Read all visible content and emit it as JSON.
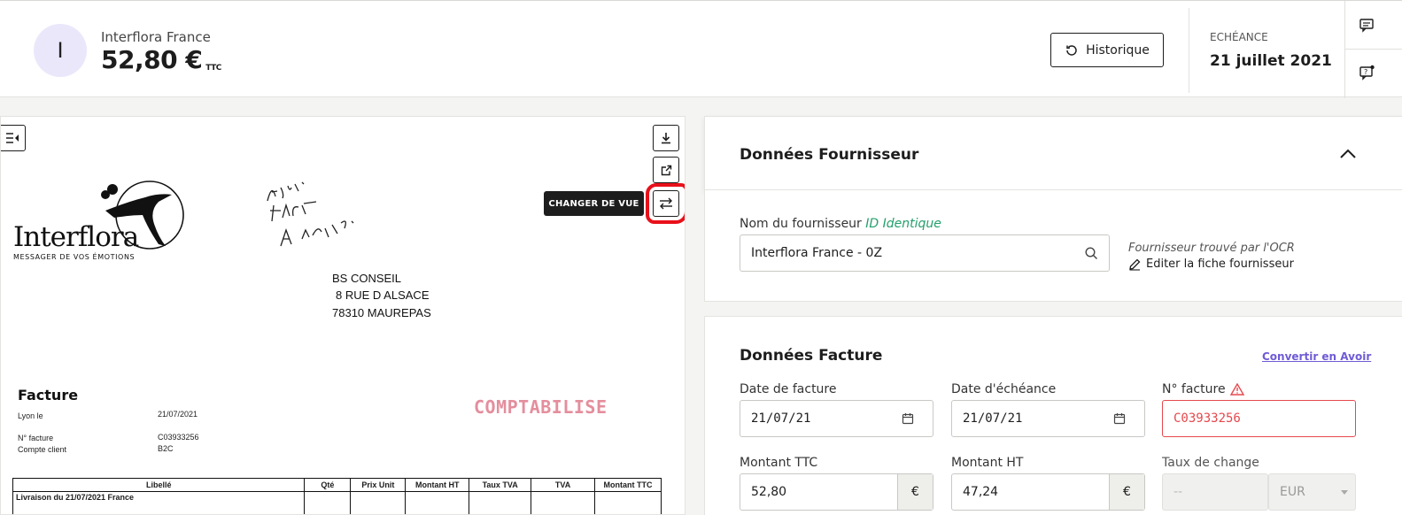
{
  "header": {
    "avatar_letter": "I",
    "supplier_name": "Interflora France",
    "amount": "52,80 €",
    "amount_suffix": "TTC",
    "history_button": "Historique",
    "due_label": "ECHÉANCE",
    "due_date": "21 juillet 2021"
  },
  "viewer": {
    "tooltip": "CHANGER DE VUE",
    "document": {
      "logo_word": "Interflora",
      "logo_tagline": "MESSAGER DE VOS ÉMOTIONS",
      "address": [
        "BS CONSEIL",
        "8 RUE D ALSACE",
        "78310 MAUREPAS"
      ],
      "title": "Facture",
      "lyon_label": "Lyon le",
      "lyon_value": "21/07/2021",
      "invoice_no_label": "N° facture",
      "invoice_no_value": "C03933256",
      "client_label": "Compte client",
      "client_value": "B2C",
      "stamp": "COMPTABILISE",
      "table_headers": [
        "Libellé",
        "Qté",
        "Prix Unit",
        "Montant HT",
        "Taux TVA",
        "TVA",
        "Montant TTC"
      ],
      "table_row": "Livraison du 21/07/2021 France"
    }
  },
  "supplier_panel": {
    "title": "Données Fournisseur",
    "name_label": "Nom du fournisseur",
    "id_tag": "ID Identique",
    "name_value": "Interflora France - 0Z",
    "ocr_note": "Fournisseur trouvé par l'OCR",
    "edit_link": "Editer la fiche fournisseur"
  },
  "invoice_panel": {
    "title": "Données Facture",
    "convert_link": "Convertir en Avoir",
    "invoice_date_label": "Date de facture",
    "invoice_date_value": "21/07/21",
    "due_date_label": "Date d'échéance",
    "due_date_value": "21/07/21",
    "invoice_no_label": "N° facture",
    "invoice_no_value": "C03933256",
    "ttc_label": "Montant TTC",
    "ttc_value": "52,80",
    "ht_label": "Montant HT",
    "ht_value": "47,24",
    "currency_symbol": "€",
    "rate_label": "Taux de change",
    "rate_placeholder": "--",
    "currency_value": "EUR"
  },
  "colors": {
    "accent": "#6f5bd6",
    "success": "#22a06b",
    "error": "#e5484d",
    "highlight_mark": "#e8101a"
  }
}
